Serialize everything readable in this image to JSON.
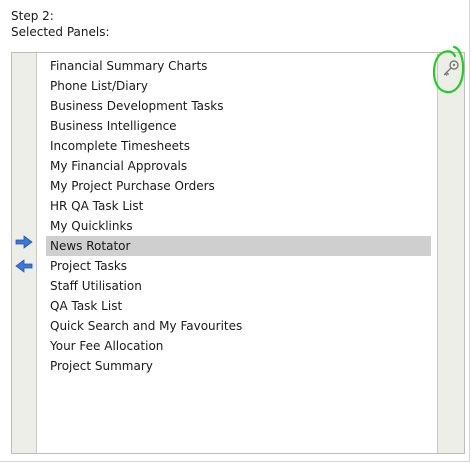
{
  "step": {
    "title": "Step 2:",
    "subtitle": "Selected Panels:"
  },
  "panels": {
    "items": [
      "Financial Summary Charts",
      "Phone List/Diary",
      "Business Development Tasks",
      "Business Intelligence",
      "Incomplete Timesheets",
      "My Financial Approvals",
      "My Project Purchase Orders",
      "HR QA Task List",
      "My Quicklinks",
      "News Rotator",
      "Project Tasks",
      "Staff Utilisation",
      "QA Task List",
      "Quick Search and My Favourites",
      "Your Fee Allocation",
      "Project Summary"
    ],
    "selected_index": 9
  },
  "icons": {
    "move_in": "arrow-right-icon",
    "move_out": "arrow-left-icon",
    "properties": "key-icon"
  },
  "colors": {
    "arrow": "#3b78d8",
    "selection": "#cfcfcf",
    "annotation": "#1fcf1f",
    "side_column": "#eeeee9"
  }
}
